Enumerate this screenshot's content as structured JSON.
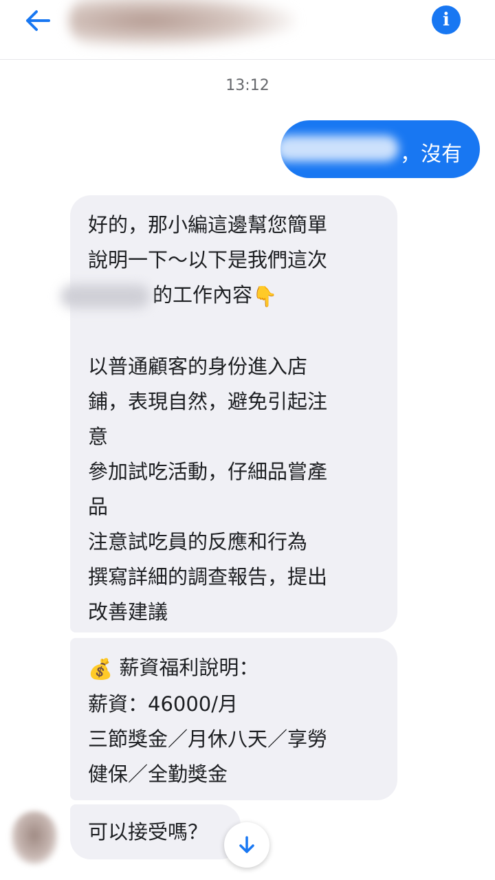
{
  "header": {
    "back_icon": "arrow-left-icon",
    "info_icon": "info-icon",
    "info_glyph": "i",
    "accent_color": "#1877f2"
  },
  "thread": {
    "timestamp": "13:12",
    "sent_message": {
      "text": "，沒有",
      "color": "#1877f2"
    },
    "received_messages": [
      {
        "lines": [
          "好的，那小編這邊幫您簡單",
          "說明一下～以下是我們這次",
          "的工作內容",
          "",
          "以普通顧客的身份進入店",
          "鋪，表現自然，避免引起注",
          "意",
          "參加試吃活動，仔細品嘗產",
          "品",
          "注意試吃員的反應和行為",
          "撰寫詳細的調查報告，提出",
          "改善建議"
        ],
        "emoji": "👇"
      },
      {
        "lines": [
          "薪資福利說明：",
          "薪資：46000/月",
          "三節獎金／月休八天／享勞",
          "健保／全勤獎金"
        ],
        "emoji": "💰"
      },
      {
        "lines": [
          "可以接受嗎？"
        ]
      }
    ],
    "bubble_color": "#f0f0f5",
    "scroll_icon": "arrow-down-icon"
  }
}
